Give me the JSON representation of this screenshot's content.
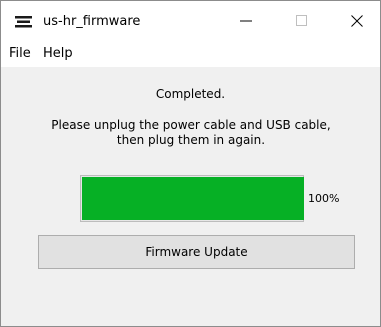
{
  "window": {
    "title": "us-hr_firmware",
    "icon": "app-icon",
    "controls": {
      "minimize": "minimize-icon",
      "maximize": "maximize-icon",
      "close": "close-icon"
    }
  },
  "menu": {
    "items": [
      "File",
      "Help"
    ]
  },
  "main": {
    "status": "Completed.",
    "message": "Please unplug the power cable and USB cable,\nthen plug them in again.",
    "progress": {
      "value": 1.0,
      "label": "100%"
    },
    "update_button": "Firmware Update"
  },
  "colors": {
    "progress_fill": "#06b025",
    "client_bg": "#f0f0f0",
    "button_bg": "#e1e1e1"
  }
}
